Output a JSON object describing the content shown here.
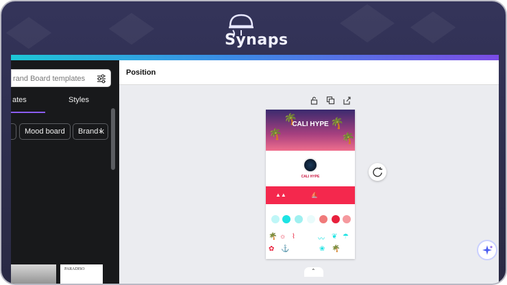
{
  "brand": {
    "name": "Synaps",
    "logo_text": "Synaps"
  },
  "colors": {
    "accent": "#8b5cf6",
    "frame_bg": "#2a2a44",
    "panel_bg": "#18191b",
    "poster_red": "#f4284d"
  },
  "left_panel": {
    "search": {
      "placeholder": "Brand Board templates",
      "visible_text": "rand Board templates"
    },
    "tabs": [
      {
        "label": "ates",
        "active": true
      },
      {
        "label": "Styles",
        "active": false
      }
    ],
    "chips": [
      "Mood board",
      "Brand k"
    ],
    "chip_next_icon": "chevron-right-icon",
    "thumbnail_text": "PARADISO"
  },
  "header": {
    "title": "Position"
  },
  "toolbar_icons": [
    "lock-icon",
    "duplicate-icon",
    "share-icon"
  ],
  "design": {
    "title": "CALI HYPE",
    "profile_name": "CALI HYPE"
  }
}
